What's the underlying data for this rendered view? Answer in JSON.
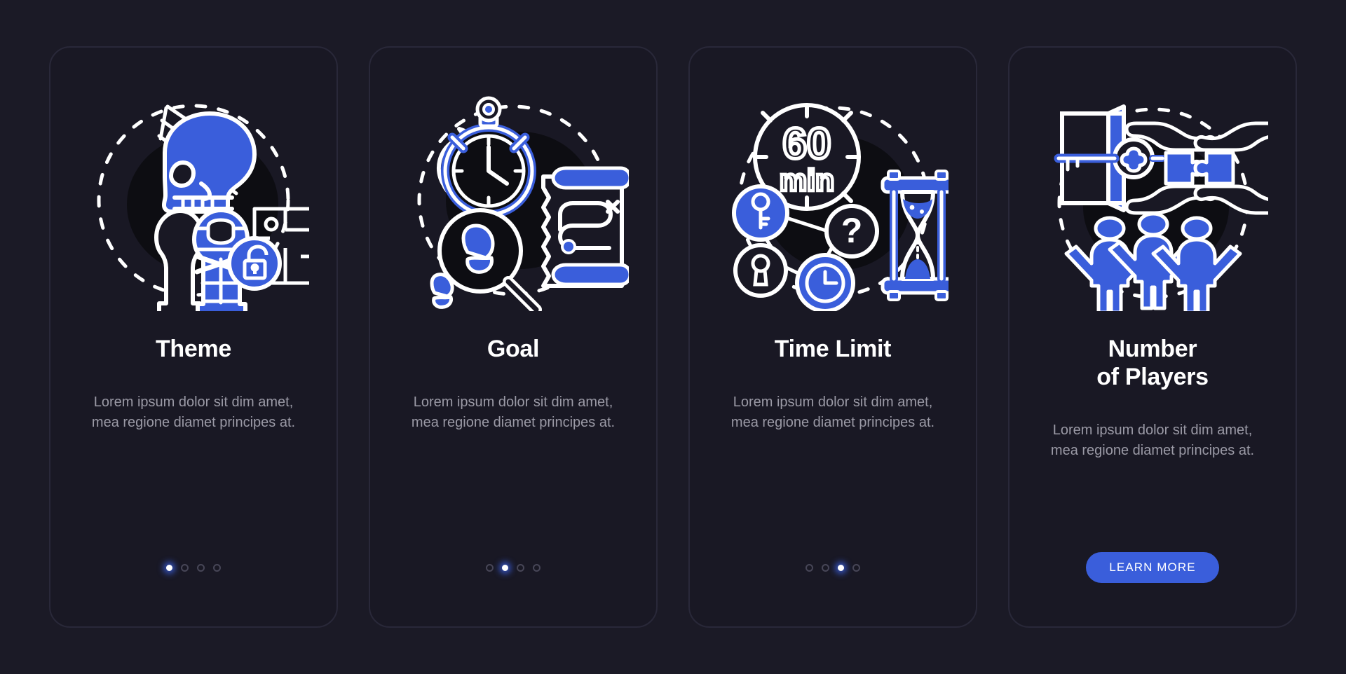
{
  "theme": {
    "background": "#1b1a26",
    "card_background": "#191824",
    "card_border": "#292839",
    "accent_blue": "#3a5edb",
    "title_color": "#ffffff",
    "body_color": "#9b9aa6",
    "dot_inactive": "#474657"
  },
  "screens": [
    {
      "id": "theme",
      "illustration": "escape-room-theme-icon",
      "title": "Theme",
      "description": "Lorem ipsum dolor sit dim amet, mea regione diamet principes at.",
      "footer": "dots",
      "dots": {
        "count": 4,
        "active": 0
      }
    },
    {
      "id": "goal",
      "illustration": "escape-room-goal-icon",
      "title": "Goal",
      "description": "Lorem ipsum dolor sit dim amet, mea regione diamet principes at.",
      "footer": "dots",
      "dots": {
        "count": 4,
        "active": 1
      }
    },
    {
      "id": "time-limit",
      "illustration": "escape-room-time-limit-icon",
      "title": "Time Limit",
      "description": "Lorem ipsum dolor sit dim amet, mea regione diamet principes at.",
      "footer": "dots",
      "dots": {
        "count": 4,
        "active": 2
      }
    },
    {
      "id": "number-of-players",
      "illustration": "escape-room-players-icon",
      "title": "Number\nof Players",
      "description": "Lorem ipsum dolor sit dim amet, mea regione diamet principes at.",
      "footer": "button",
      "button_label": "LEARN MORE"
    }
  ],
  "illustration_text": {
    "clock_number": "60",
    "clock_unit": "min"
  }
}
